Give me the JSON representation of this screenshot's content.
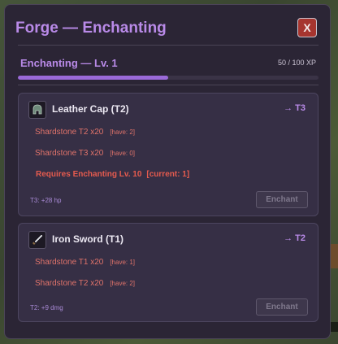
{
  "window": {
    "title": "Forge — Enchanting",
    "close_label": "X"
  },
  "skill": {
    "label": "Enchanting — Lv. 1",
    "xp_text": "50 / 100 XP",
    "xp_current": 50,
    "xp_max": 100
  },
  "items": [
    {
      "name": "Leather Cap (T2)",
      "icon": "helmet-icon",
      "target_tier": "→ T3",
      "requirements": [
        {
          "text": "Shardstone T2 x20",
          "have": "[have: 2]"
        },
        {
          "text": "Shardstone T3 x20",
          "have": "[have: 0]"
        }
      ],
      "warning": "Requires Enchanting Lv. 10",
      "warning_current": "[current: 1]",
      "bonus": "T3: +28 hp",
      "button_label": "Enchant"
    },
    {
      "name": "Iron Sword (T1)",
      "icon": "sword-icon",
      "target_tier": "→ T2",
      "requirements": [
        {
          "text": "Shardstone T1 x20",
          "have": "[have: 1]"
        },
        {
          "text": "Shardstone T2 x20",
          "have": "[have: 2]"
        }
      ],
      "bonus": "T2: +9 dmg",
      "button_label": "Enchant"
    }
  ],
  "colors": {
    "accent": "#b98ae8",
    "warning": "#e65b4e",
    "close": "#a6352f"
  }
}
